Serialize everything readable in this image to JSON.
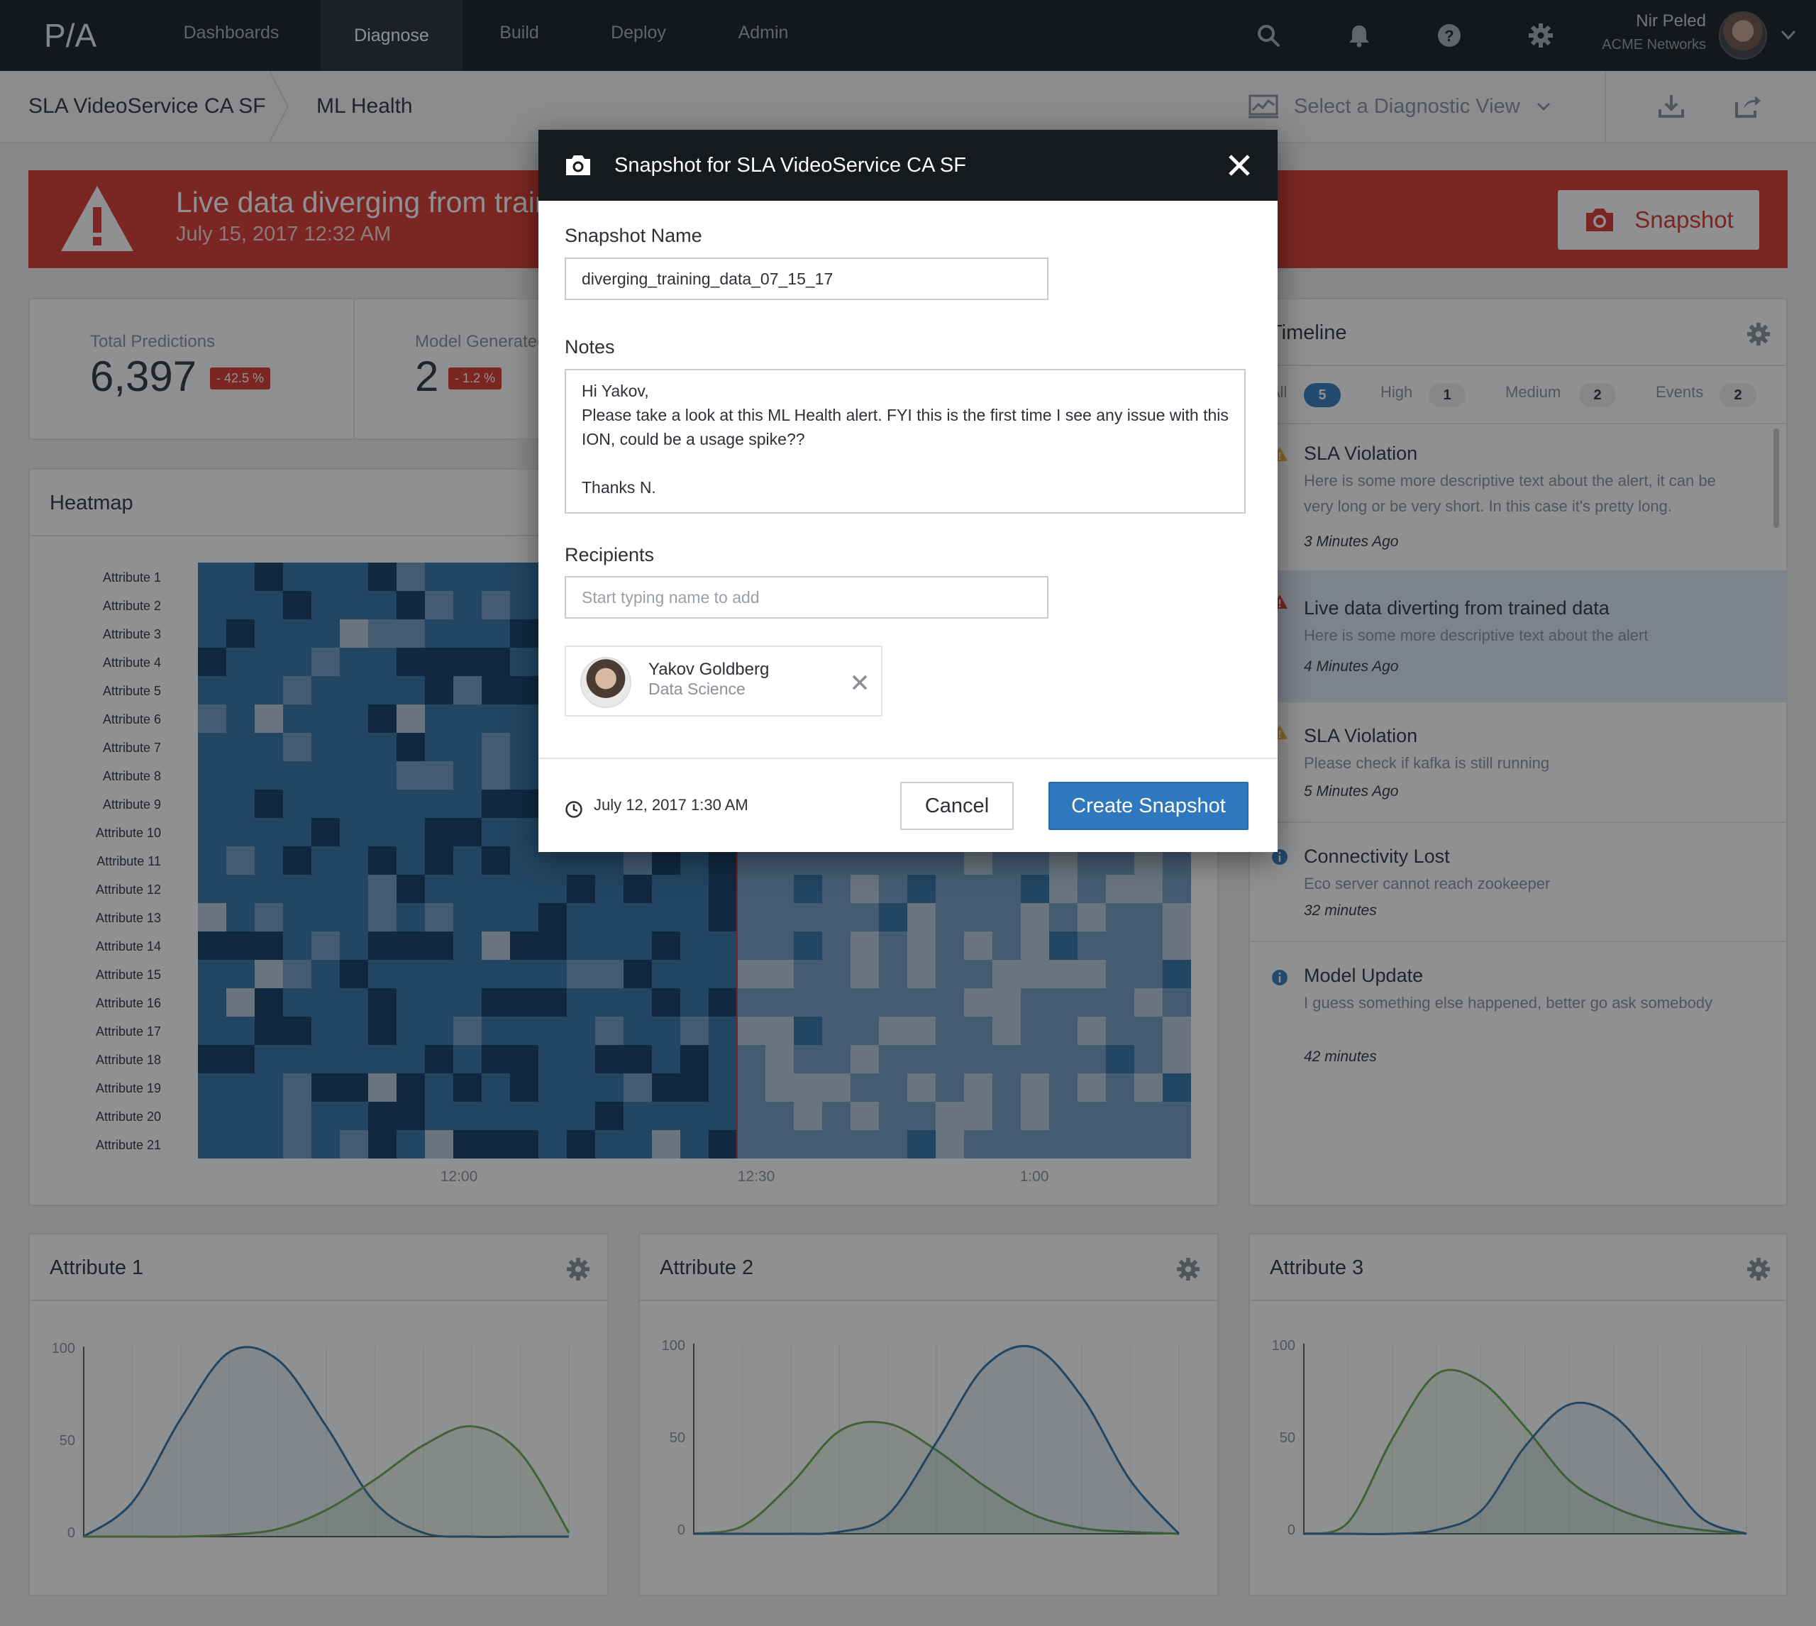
{
  "nav": {
    "logo": "P/A",
    "tabs": [
      {
        "label": "Dashboards"
      },
      {
        "label": "Diagnose",
        "active": true
      },
      {
        "label": "Build"
      },
      {
        "label": "Deploy"
      },
      {
        "label": "Admin"
      }
    ],
    "icons": [
      "search-icon",
      "bell-icon",
      "help-icon",
      "gear-icon"
    ],
    "user": {
      "name": "Nir Peled",
      "org": "ACME Networks"
    }
  },
  "breadcrumb": {
    "items": [
      "SLA VideoService CA SF",
      "ML Health"
    ],
    "diagnostic_view_placeholder": "Select a Diagnostic View"
  },
  "alert": {
    "title": "Live data diverging from trained data",
    "date": "July 15, 2017  12:32 AM",
    "snapshot_label": "Snapshot",
    "color": "#d9342b"
  },
  "stats": [
    {
      "label": "Total Predictions",
      "value": "6,397",
      "change": "- 42.5 %"
    },
    {
      "label": "Model Generated Alerts",
      "value": "2",
      "change": "- 1.2 %"
    }
  ],
  "heatmap": {
    "title": "Heatmap",
    "rows": [
      "Attribute 1",
      "Attribute 2",
      "Attribute 3",
      "Attribute 4",
      "Attribute 5",
      "Attribute 6",
      "Attribute 7",
      "Attribute 8",
      "Attribute 9",
      "Attribute 10",
      "Attribute 11",
      "Attribute 12",
      "Attribute 13",
      "Attribute 14",
      "Attribute 15",
      "Attribute 16",
      "Attribute 17",
      "Attribute 18",
      "Attribute 19",
      "Attribute 20",
      "Attribute 21"
    ],
    "x_ticks": [
      "12:00",
      "12:30",
      "1:00"
    ],
    "colors": {
      "dark": "#0e3a64",
      "mid": "#2f6fa4",
      "light": "#6f9cc4",
      "pale": "#b7c9dc",
      "marker": "#d9342b"
    }
  },
  "timeline": {
    "title": "Timeline",
    "filters": [
      {
        "label": "All",
        "count": "5",
        "active": true
      },
      {
        "label": "High",
        "count": "1"
      },
      {
        "label": "Medium",
        "count": "2"
      },
      {
        "label": "Events",
        "count": "2"
      }
    ],
    "items": [
      {
        "icon": "warning-icon",
        "title": "SLA Violation",
        "desc": "Here is some more descriptive text about the alert, it can be very long or be very short. In this case it's pretty long.",
        "time": "3 Minutes Ago"
      },
      {
        "icon": "error-icon",
        "title": "Live data diverting from trained data",
        "desc": "Here is some more descriptive text about the alert",
        "time": "4 Minutes Ago",
        "selected": true
      },
      {
        "icon": "warning-icon",
        "title": "SLA Violation",
        "desc": "Please check if kafka is still running",
        "time": "5 Minutes Ago"
      },
      {
        "icon": "info-icon",
        "title": "Connectivity Lost",
        "desc": "Eco server cannot reach zookeeper",
        "time": "32 minutes"
      },
      {
        "icon": "info-icon",
        "title": "Model Update",
        "desc": "I guess something else happened, better go ask somebody",
        "time": "42 minutes"
      }
    ]
  },
  "charts": [
    {
      "title": "Attribute 1"
    },
    {
      "title": "Attribute 2"
    },
    {
      "title": "Attribute 3"
    }
  ],
  "chart_data": [
    {
      "type": "area",
      "title": "Attribute 1",
      "ylim": [
        0,
        100
      ],
      "yticks": [
        0,
        50,
        100
      ],
      "series": [
        {
          "color": "#2f6fa4",
          "x": [
            0,
            10,
            20,
            30,
            40,
            50,
            60,
            70,
            80,
            90,
            100
          ],
          "values": [
            0,
            18,
            62,
            97,
            93,
            58,
            18,
            2,
            0,
            0,
            0
          ]
        },
        {
          "color": "#6aa84f",
          "x": [
            0,
            10,
            20,
            30,
            40,
            50,
            60,
            70,
            80,
            90,
            100
          ],
          "values": [
            0,
            0,
            0,
            1,
            4,
            14,
            30,
            48,
            58,
            44,
            2
          ]
        }
      ]
    },
    {
      "type": "area",
      "title": "Attribute 2",
      "ylim": [
        0,
        100
      ],
      "yticks": [
        0,
        50,
        100
      ],
      "series": [
        {
          "color": "#6aa84f",
          "x": [
            0,
            10,
            20,
            30,
            40,
            50,
            60,
            70,
            80,
            90,
            100
          ],
          "values": [
            0,
            4,
            26,
            54,
            58,
            44,
            25,
            10,
            3,
            1,
            0
          ]
        },
        {
          "color": "#2f6fa4",
          "x": [
            0,
            10,
            20,
            30,
            40,
            50,
            60,
            70,
            80,
            90,
            100
          ],
          "values": [
            0,
            0,
            0,
            1,
            10,
            48,
            88,
            98,
            72,
            28,
            0
          ]
        }
      ]
    },
    {
      "type": "area",
      "title": "Attribute 3",
      "ylim": [
        0,
        100
      ],
      "yticks": [
        0,
        50,
        100
      ],
      "series": [
        {
          "color": "#6aa84f",
          "x": [
            0,
            10,
            20,
            30,
            40,
            50,
            60,
            70,
            80,
            90,
            100
          ],
          "values": [
            0,
            6,
            50,
            84,
            80,
            56,
            28,
            14,
            6,
            2,
            0
          ]
        },
        {
          "color": "#2f6fa4",
          "x": [
            0,
            10,
            20,
            30,
            40,
            50,
            60,
            70,
            80,
            90,
            100
          ],
          "values": [
            0,
            0,
            0,
            2,
            12,
            46,
            68,
            62,
            36,
            8,
            0
          ]
        }
      ]
    }
  ],
  "modal": {
    "title": "Snapshot for SLA VideoService CA SF",
    "name_label": "Snapshot Name",
    "name_value": "diverging_training_data_07_15_17",
    "notes_label": "Notes",
    "notes_value": "Hi Yakov,\nPlease take a look at this ML Health alert. FYI this is the first time I see any issue with this ION, could be a usage spike??\n\nThanks N.",
    "recipients_label": "Recipients",
    "recipients_placeholder": "Start typing name to add",
    "recipient": {
      "name": "Yakov Goldberg",
      "role": "Data Science"
    },
    "date": "July 12, 2017  1:30 AM",
    "cancel_label": "Cancel",
    "create_label": "Create Snapshot"
  }
}
